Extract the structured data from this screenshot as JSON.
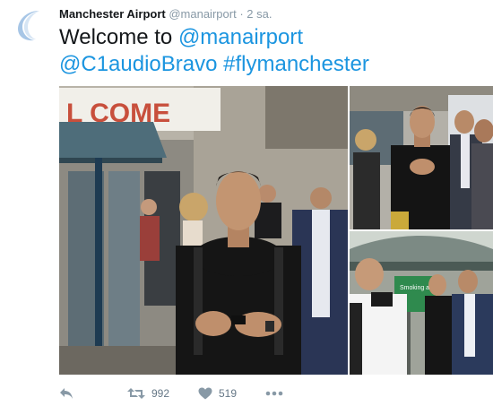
{
  "tweet": {
    "author_name": "Manchester Airport",
    "author_handle": "@manairport",
    "separator": "·",
    "timestamp": "2 sa.",
    "text_part1": "Welcome to ",
    "mention1": "@manairport",
    "mention2": "@C1audioBravo",
    "text_space": " ",
    "hashtag": "#flymanchester"
  },
  "media": {
    "sign_text": "L COME",
    "smoking_sign": "Smoking area"
  },
  "actions": {
    "retweets": "992",
    "likes": "519"
  },
  "colors": {
    "link": "#1b95e0",
    "muted": "#8899a6",
    "avatar": "#a7c6e6"
  },
  "icons": [
    "avatar-logo-icon",
    "reply-icon",
    "retweet-icon",
    "heart-icon",
    "more-icon"
  ]
}
